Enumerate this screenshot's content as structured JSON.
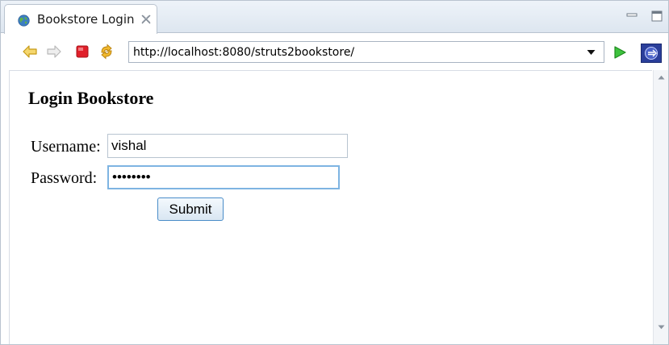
{
  "tab": {
    "title": "Bookstore Login",
    "icon": "globe-icon",
    "close_icon": "close-icon"
  },
  "window_controls": {
    "minimize_icon": "minimize-icon",
    "maximize_icon": "maximize-icon"
  },
  "toolbar": {
    "back_icon": "back-arrow-icon",
    "forward_icon": "forward-arrow-icon",
    "stop_icon": "stop-icon",
    "refresh_icon": "refresh-icon",
    "url": "http://localhost:8080/struts2bookstore/",
    "go_icon": "go-icon",
    "eclipse_icon": "eclipse-icon"
  },
  "page": {
    "title": "Login Bookstore",
    "username_label": "Username:",
    "username_value": "vishal",
    "password_label": "Password:",
    "password_value": "vishal12",
    "submit_label": "Submit"
  },
  "colors": {
    "accent": "#4a8dc9",
    "stop": "#e0202a",
    "go": "#2eaa2e",
    "eclipse": "#2a3e9a"
  }
}
